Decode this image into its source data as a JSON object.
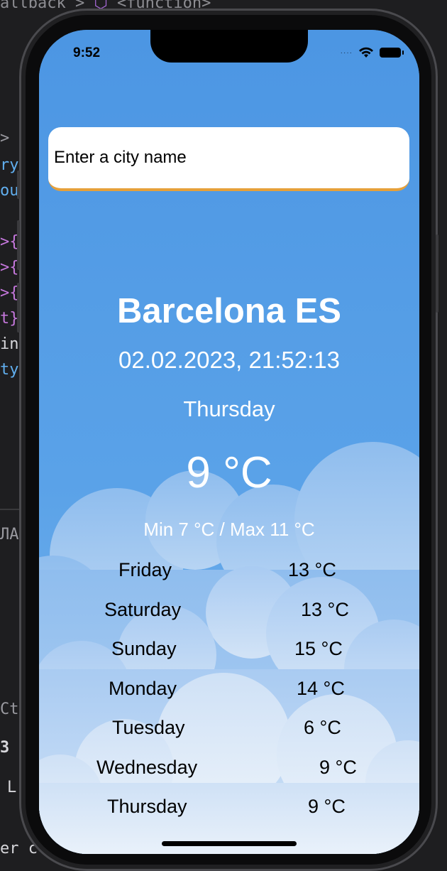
{
  "editor": {
    "breadcrumb": "allback",
    "breadcrumb_sep": ">",
    "breadcrumb_fn": "<function>",
    "lines": [
      ">",
      "ry",
      "our",
      ">{",
      ">{",
      ">{",
      "t}",
      "in",
      "ty"
    ],
    "bottom_lines": [
      "ЛА",
      "Ct",
      "3",
      "L",
      "er c"
    ]
  },
  "status_bar": {
    "time": "9:52",
    "signal": "····",
    "wifi_icon": "wifi-icon",
    "battery_icon": "battery-icon"
  },
  "search": {
    "placeholder": "Enter a city name",
    "value": "",
    "underline_color": "#e6a03a"
  },
  "weather": {
    "city": "Barcelona ES",
    "datetime": "02.02.2023, 21:52:13",
    "weekday": "Thursday",
    "temperature": "9 °C",
    "minmax": "Min 7  °C / Max 11 °C"
  },
  "forecast": [
    {
      "day": "Friday",
      "temp": "13 °C"
    },
    {
      "day": "Saturday",
      "temp": "13 °C"
    },
    {
      "day": "Sunday",
      "temp": "15 °C"
    },
    {
      "day": "Monday",
      "temp": "14 °C"
    },
    {
      "day": "Tuesday",
      "temp": "6 °C"
    },
    {
      "day": "Wednesday",
      "temp": "9 °C"
    },
    {
      "day": "Thursday",
      "temp": "9 °C"
    }
  ],
  "colors": {
    "sky": "#4e97e3",
    "cloud": "#dbe9f7",
    "accent": "#e6a03a"
  }
}
